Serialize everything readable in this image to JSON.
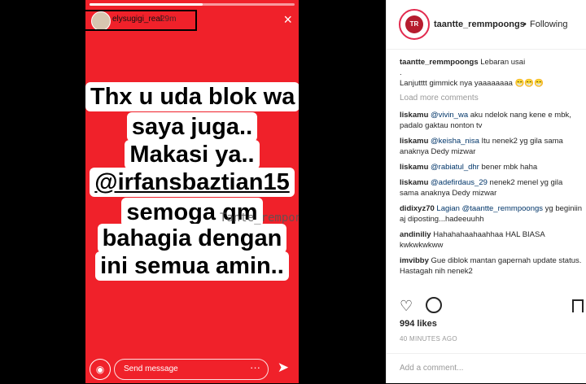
{
  "story": {
    "username": "elysugigi_real",
    "time": "29m",
    "progress": 0.55,
    "close_glyph": "×",
    "lines": [
      "Thx u uda blok wa",
      "saya juga..",
      "Makasi ya..",
      "@irfansbaztian15",
      "semoga qm",
      "bahagia dengan",
      "ini semua amin.."
    ],
    "watermark": "Tante_rempong",
    "send_placeholder": "Send message",
    "more_glyph": "···",
    "icons": {
      "camera": "camera-icon",
      "send": "paper-plane-icon",
      "close": "close-icon"
    }
  },
  "post": {
    "username": "taantte_remmpoongs",
    "dot": "•",
    "follow_label": "Following",
    "caption_user": "taantte_remmpoongs",
    "caption_text": "Lebaran usai",
    "caption_line2": ".",
    "caption_line3": "Lanjutttt gimmick nya yaaaaaaaa 😁😁😁",
    "load_more": "Load more comments",
    "comments": [
      {
        "user": "liskamu",
        "mention": "@vivin_wa",
        "text": "aku ndelok nang kene e mbk, padalo gaktau nonton tv"
      },
      {
        "user": "liskamu",
        "mention": "@keisha_nisa",
        "text": "Itu nenek2 yg gila sama anaknya Dedy mizwar"
      },
      {
        "user": "liskamu",
        "mention": "@rabiatul_dhr",
        "text": "bener mbk haha"
      },
      {
        "user": "liskamu",
        "mention": "@adefirdaus_29",
        "text": "nenek2 menel yg gila sama anaknya Dedy mizwar"
      },
      {
        "user": "didixyz70",
        "mention": "Lagian @taantte_remmpoongs",
        "text": "yg beginiin aj diposting...hadeeuuhh"
      },
      {
        "user": "andiniliy",
        "mention": "",
        "text": "Hahahahaahaahhaa HAL BIASA kwkwkwkww"
      },
      {
        "user": "imvibby",
        "mention": "",
        "text": "Gue diblok mantan gapernah update status. Hastagah nih nenek2"
      }
    ],
    "likes": "994 likes",
    "time_ago": "40 MINUTES AGO",
    "add_comment_placeholder": "Add a comment..."
  }
}
